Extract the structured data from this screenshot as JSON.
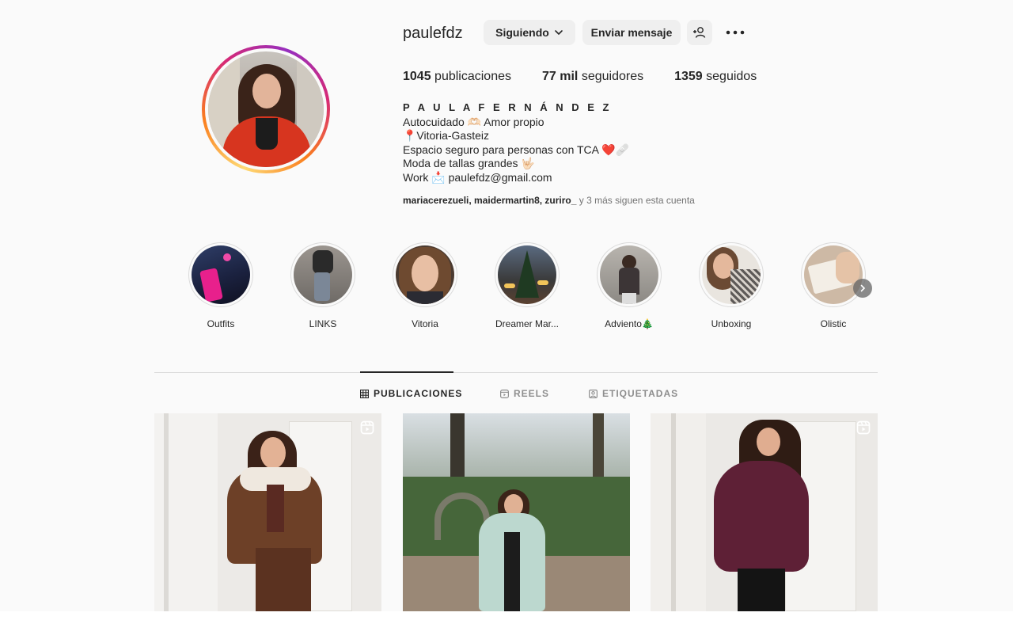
{
  "profile": {
    "username": "paulefdz",
    "following_button": "Siguiendo",
    "message_button": "Enviar mensaje",
    "stats": {
      "posts_count": "1045",
      "posts_label": "publicaciones",
      "followers_count": "77 mil",
      "followers_label": "seguidores",
      "following_count": "1359",
      "following_label": "seguidos"
    },
    "full_name": "P A U L A F E R N Á N D E Z",
    "bio_lines": [
      "Autocuidado 🫶🏻 Amor propio",
      "📍Vitoria-Gasteiz",
      "Espacio seguro para personas con TCA ❤️🩹",
      "Moda de tallas grandes 🤟🏻",
      "Work 📩 paulefdz@gmail.com"
    ],
    "followed_by_names": "mariacerezueli, maidermartin8, zuriro_",
    "followed_by_suffix": " y 3 más siguen esta cuenta"
  },
  "highlights": [
    {
      "label": "Outfits"
    },
    {
      "label": "LINKS"
    },
    {
      "label": "Vitoria"
    },
    {
      "label": "Dreamer Mar..."
    },
    {
      "label": "Adviento🎄"
    },
    {
      "label": "Unboxing"
    },
    {
      "label": "Olistic"
    }
  ],
  "tabs": {
    "posts": "PUBLICACIONES",
    "reels": "REELS",
    "tagged": "ETIQUETADAS"
  },
  "icons": {
    "following_chevron": "chevron-down-icon",
    "add_user": "add-user-icon",
    "more": "more-options-icon",
    "grid": "grid-icon",
    "reels": "reels-icon",
    "tagged": "tagged-icon",
    "reel_badge": "reel-badge-icon",
    "highlights_next": "chevron-right-icon"
  },
  "colors": {
    "text": "#262626",
    "muted": "#737373",
    "button_bg": "#efefef",
    "background": "#fafafa",
    "ring_gradient_start": "#feda75",
    "ring_gradient_end": "#962fbf"
  }
}
